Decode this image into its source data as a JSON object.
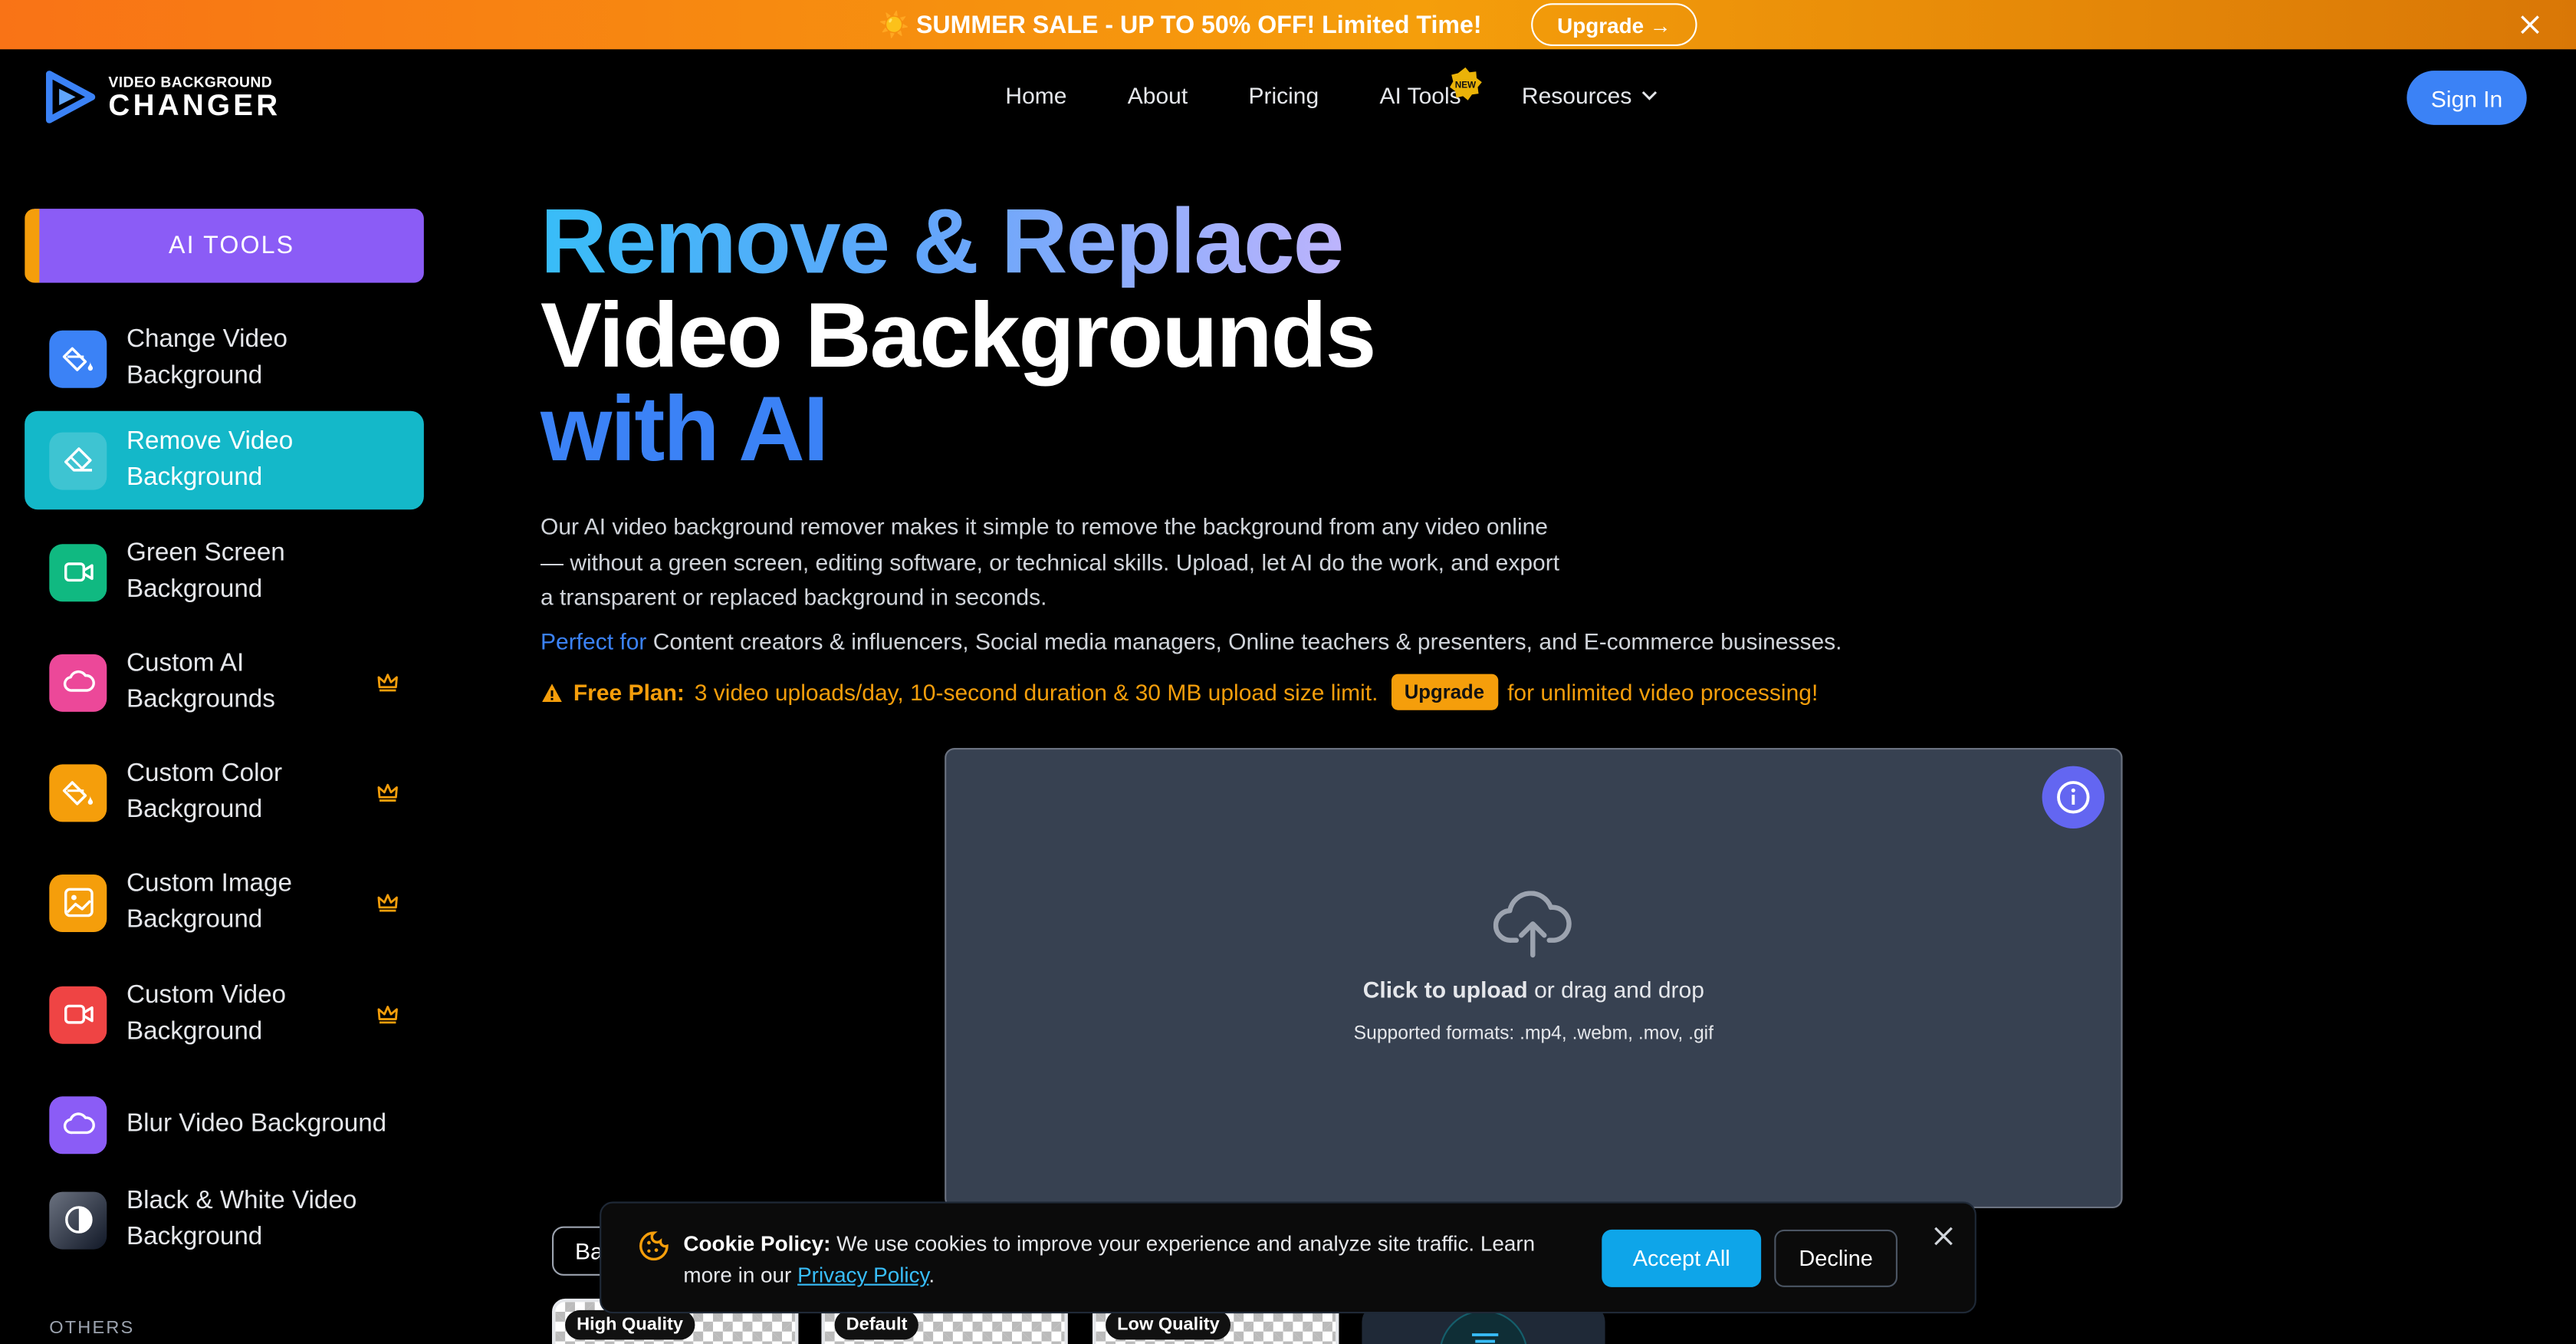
{
  "promo": {
    "text": "☀️ SUMMER SALE - UP TO 50% OFF! Limited Time!",
    "button": "Upgrade →"
  },
  "logo": {
    "top": "VIDEO BACKGROUND",
    "bottom": "CHANGER"
  },
  "nav": {
    "home": "Home",
    "about": "About",
    "pricing": "Pricing",
    "ai_tools": "AI Tools",
    "resources": "Resources",
    "new_badge": "NEW"
  },
  "signin": "Sign In",
  "sidebar": {
    "header": "AI TOOLS",
    "items": [
      {
        "label": "Change Video Background",
        "icon": "paint-bucket-icon",
        "color": "#3b82f6",
        "premium": false
      },
      {
        "label": "Remove Video Background",
        "icon": "eraser-icon",
        "color": "#14b8c9",
        "premium": false,
        "active": true
      },
      {
        "label": "Green Screen Background",
        "icon": "video-camera-icon",
        "color": "#10b981",
        "premium": false
      },
      {
        "label": "Custom AI Backgrounds",
        "icon": "cloud-icon",
        "color": "#ec4899",
        "premium": true
      },
      {
        "label": "Custom Color Background",
        "icon": "paint-bucket-icon",
        "color": "#f59e0b",
        "premium": true
      },
      {
        "label": "Custom Image Background",
        "icon": "image-icon",
        "color": "#f59e0b",
        "premium": true
      },
      {
        "label": "Custom Video Background",
        "icon": "video-camera-icon",
        "color": "#ef4444",
        "premium": true
      },
      {
        "label": "Blur Video Background",
        "icon": "cloud-icon",
        "color": "#8b5cf6",
        "premium": false
      },
      {
        "label": "Black & White Video Background",
        "icon": "contrast-icon",
        "color": "#374151",
        "premium": false
      }
    ],
    "others": "OTHERS"
  },
  "hero": {
    "line1": "Remove & Replace",
    "line2": "Video Backgrounds",
    "line3": "with AI",
    "description": "Our AI video background remover makes it simple to remove the background from any video online — without a green screen, editing software, or technical skills. Upload, let AI do the work, and export a transparent or replaced background in seconds.",
    "perfect_label": "Perfect for",
    "perfect_text": "Content creators & influencers, Social media managers, Online teachers & presenters, and E-commerce businesses.",
    "free_label": "Free Plan:",
    "free_text": "3 video uploads/day, 10-second duration & 30 MB upload size limit.",
    "upgrade": "Upgrade",
    "free_tail": "for unlimited video processing!"
  },
  "upload": {
    "click": "Click to upload",
    "drag": "or drag and drop",
    "formats": "Supported formats: .mp4, .webm, .mov, .gif"
  },
  "quality": {
    "ba": "Ba",
    "high": "High Quality",
    "default": "Default",
    "low": "Low Quality"
  },
  "cookie": {
    "title": "Cookie Policy:",
    "text": "We use cookies to improve your experience and analyze site traffic. Learn more in our",
    "link": "Privacy Policy",
    "period": ".",
    "accept": "Accept All",
    "decline": "Decline"
  }
}
